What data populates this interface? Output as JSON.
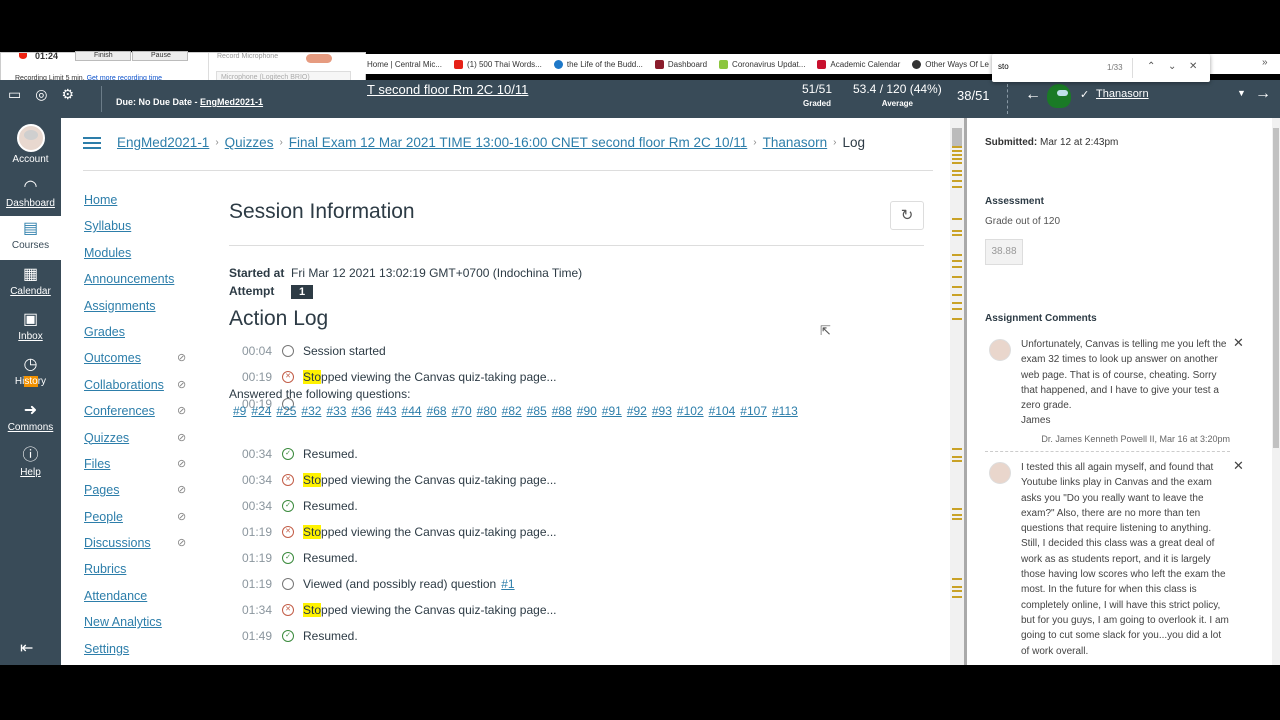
{
  "recorder": {
    "time": "01:24",
    "finish_label": "Finish",
    "pause_label": "Pause",
    "limit_text": "Recording Limit 5 min.",
    "more_time_link": "Get more recording time",
    "mic_label": "Record Microphone",
    "mic_device": "Microphone (Logitech BRIO)"
  },
  "bookmarks": [
    {
      "label": "Home | Central Mic...",
      "color": "#ffffff"
    },
    {
      "label": "(1) 500 Thai Words...",
      "color": "#e62117"
    },
    {
      "label": "the Life of the Budd...",
      "color": "#1e78c8"
    },
    {
      "label": "Dashboard",
      "color": "#8a1c2b"
    },
    {
      "label": "Coronavirus Updat...",
      "color": "#8cc63f"
    },
    {
      "label": "Academic Calendar",
      "color": "#c8102e"
    },
    {
      "label": "Other Ways Of Le",
      "color": "#333333"
    }
  ],
  "findbar": {
    "query": "sto",
    "count": "1/33",
    "up": "^",
    "down": "v",
    "close": "✕"
  },
  "header": {
    "due_label": "Due: No Due Date -",
    "due_course": "EngMed2021-1",
    "title_fragment": "T second floor Rm 2C 10/11",
    "graded_value": "51/51",
    "graded_label": "Graded",
    "average_value": "53.4 / 120 (44%)",
    "average_label": "Average",
    "position": "38/51",
    "student_name": "Thanasorn"
  },
  "globalnav": {
    "items": [
      {
        "label": "Account"
      },
      {
        "label": "Dashboard"
      },
      {
        "label": "Courses"
      },
      {
        "label": "Calendar"
      },
      {
        "label": "Inbox"
      },
      {
        "label_pre": "Hi",
        "label_hl": "sto",
        "label_post": "ry"
      },
      {
        "label": "Commons"
      },
      {
        "label": "Help"
      }
    ]
  },
  "breadcrumb": {
    "course": "EngMed2021-1",
    "quizzes": "Quizzes",
    "quiz": "Final Exam 12 Mar 2021 TIME 13:00-16:00 CNET second floor Rm 2C 10/11",
    "student": "Thanasorn",
    "current": "Log"
  },
  "coursenav": [
    {
      "label": "Home",
      "hidden": false
    },
    {
      "label": "Syllabus",
      "hidden": false
    },
    {
      "label": "Modules",
      "hidden": false
    },
    {
      "label": "Announcements",
      "hidden": false
    },
    {
      "label": "Assignments",
      "hidden": false
    },
    {
      "label": "Grades",
      "hidden": false
    },
    {
      "label": "Outcomes",
      "hidden": true
    },
    {
      "label": "Collaborations",
      "hidden": true
    },
    {
      "label": "Conferences",
      "hidden": true
    },
    {
      "label": "Quizzes",
      "hidden": true
    },
    {
      "label": "Files",
      "hidden": true
    },
    {
      "label": "Pages",
      "hidden": true
    },
    {
      "label": "People",
      "hidden": true
    },
    {
      "label": "Discussions",
      "hidden": true
    },
    {
      "label": "Rubrics",
      "hidden": false
    },
    {
      "label": "Attendance",
      "hidden": false
    },
    {
      "label": "New Analytics",
      "hidden": false
    },
    {
      "label": "Settings",
      "hidden": false
    }
  ],
  "session": {
    "title": "Session Information",
    "started_label": "Started at",
    "started_value": "Fri Mar 12 2021 13:02:19 GMT+0700 (Indochina Time)",
    "attempt_label": "Attempt",
    "attempt_value": "1"
  },
  "action_log": {
    "title": "Action Log",
    "answered_label": "Answered the following questions:",
    "answered_questions": [
      "#9",
      "#24",
      "#25",
      "#32",
      "#33",
      "#36",
      "#43",
      "#44",
      "#68",
      "#70",
      "#80",
      "#82",
      "#85",
      "#88",
      "#90",
      "#91",
      "#92",
      "#93",
      "#102",
      "#104",
      "#107",
      "#113"
    ],
    "entries": [
      {
        "time": "00:04",
        "status": "neutral",
        "text": "Session started"
      },
      {
        "time": "00:19",
        "status": "stopped",
        "hl": "Sto",
        "text": "pped viewing the Canvas quiz-taking page..."
      },
      {
        "time": "00:19",
        "status": "neutral",
        "text": ""
      },
      {
        "time": "00:34",
        "status": "resumed",
        "text": "Resumed."
      },
      {
        "time": "00:34",
        "status": "stopped",
        "hl": "Sto",
        "text": "pped viewing the Canvas quiz-taking page..."
      },
      {
        "time": "00:34",
        "status": "resumed",
        "text": "Resumed."
      },
      {
        "time": "01:19",
        "status": "stopped",
        "hl": "Sto",
        "text": "pped viewing the Canvas quiz-taking page..."
      },
      {
        "time": "01:19",
        "status": "resumed",
        "text": "Resumed."
      },
      {
        "time": "01:19",
        "status": "neutral",
        "text": "Viewed (and possibly read) question",
        "link": "#1"
      },
      {
        "time": "01:34",
        "status": "stopped",
        "hl": "Sto",
        "text": "pped viewing the Canvas quiz-taking page..."
      },
      {
        "time": "01:49",
        "status": "resumed",
        "text": "Resumed."
      }
    ]
  },
  "right_panel": {
    "submitted_label": "Submitted:",
    "submitted_value": "Mar 12 at 2:43pm",
    "assessment_label": "Assessment",
    "grade_out_of": "Grade out of 120",
    "grade_value": "38.88",
    "comments_label": "Assignment Comments",
    "comments": [
      {
        "text": "Unfortunately, Canvas is telling me you left the exam 32 times to look up answer on another web page. That is of course, cheating. Sorry that happened, and I have to give your test a zero grade.",
        "signature": "James",
        "author": "Dr. James Kenneth Powell II, Mar 16 at 3:20pm"
      },
      {
        "text": "I tested this all again myself, and found that Youtube links play in Canvas and the exam asks you \"Do you really want to leave the exam?\" Also, there are no more than ten questions that require listening to anything. Still, I decided this class was a great deal of work as as students report, and it is largely those having low scores who left the exam the most. In the future for when this class is completely online, I will have this strict policy, but for you guys, I am going to overlook it. I am going to cut some slack for you...you did a lot of work overall."
      }
    ]
  }
}
